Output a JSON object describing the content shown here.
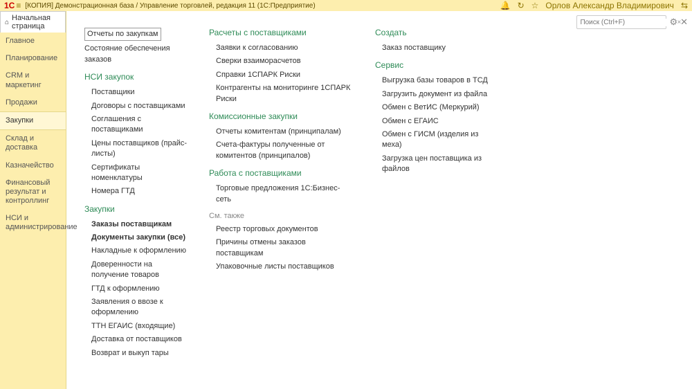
{
  "titlebar": {
    "logo": "1С",
    "title": "[КОПИЯ] Демонстрационная база / Управление торговлей, редакция 11  (1С:Предприятие)",
    "user": "Орлов Александр Владимирович"
  },
  "home_tab": "Начальная страница",
  "sidebar": {
    "items": [
      "Главное",
      "Планирование",
      "CRM и маркетинг",
      "Продажи",
      "Закупки",
      "Склад и доставка",
      "Казначейство",
      "Финансовый результат и контроллинг",
      "НСИ и администрирование"
    ]
  },
  "search": {
    "placeholder": "Поиск (Ctrl+F)"
  },
  "col1": {
    "top0": "Отчеты по закупкам",
    "top1": "Состояние обеспечения заказов",
    "sec1_title": "НСИ закупок",
    "sec1_items": [
      "Поставщики",
      "Договоры с поставщиками",
      "Соглашения с поставщиками",
      "Цены поставщиков (прайс-листы)",
      "Сертификаты номенклатуры",
      "Номера ГТД"
    ],
    "sec2_title": "Закупки",
    "sec2_items": [
      "Заказы поставщикам",
      "Документы закупки (все)",
      "Накладные к оформлению",
      "Доверенности на получение товаров",
      "ГТД к оформлению",
      "Заявления о ввозе к оформлению",
      "ТТН ЕГАИС (входящие)",
      "Доставка от поставщиков",
      "Возврат и выкуп тары"
    ]
  },
  "col2": {
    "sec1_title": "Расчеты с поставщиками",
    "sec1_items": [
      "Заявки к согласованию",
      "Сверки взаиморасчетов",
      "Справки 1СПАРК Риски",
      "Контрагенты на мониторинге 1СПАРК Риски"
    ],
    "sec2_title": "Комиссионные закупки",
    "sec2_items": [
      "Отчеты комитентам (принципалам)",
      "Счета-фактуры полученные от комитентов (принципалов)"
    ],
    "sec3_title": "Работа с поставщиками",
    "sec3_items": [
      "Торговые предложения 1С:Бизнес-сеть"
    ],
    "see_also": "См. также",
    "see_also_items": [
      "Реестр торговых документов",
      "Причины отмены заказов поставщикам",
      "Упаковочные листы поставщиков"
    ]
  },
  "col3": {
    "sec1_title": "Создать",
    "sec1_items": [
      "Заказ поставщику"
    ],
    "sec2_title": "Сервис",
    "sec2_items": [
      "Выгрузка базы товаров в ТСД",
      "Загрузить документ из файла",
      "Обмен с ВетИС (Меркурий)",
      "Обмен с ЕГАИС",
      "Обмен с ГИСМ (изделия из меха)",
      "Загрузка цен поставщика из файлов"
    ]
  }
}
